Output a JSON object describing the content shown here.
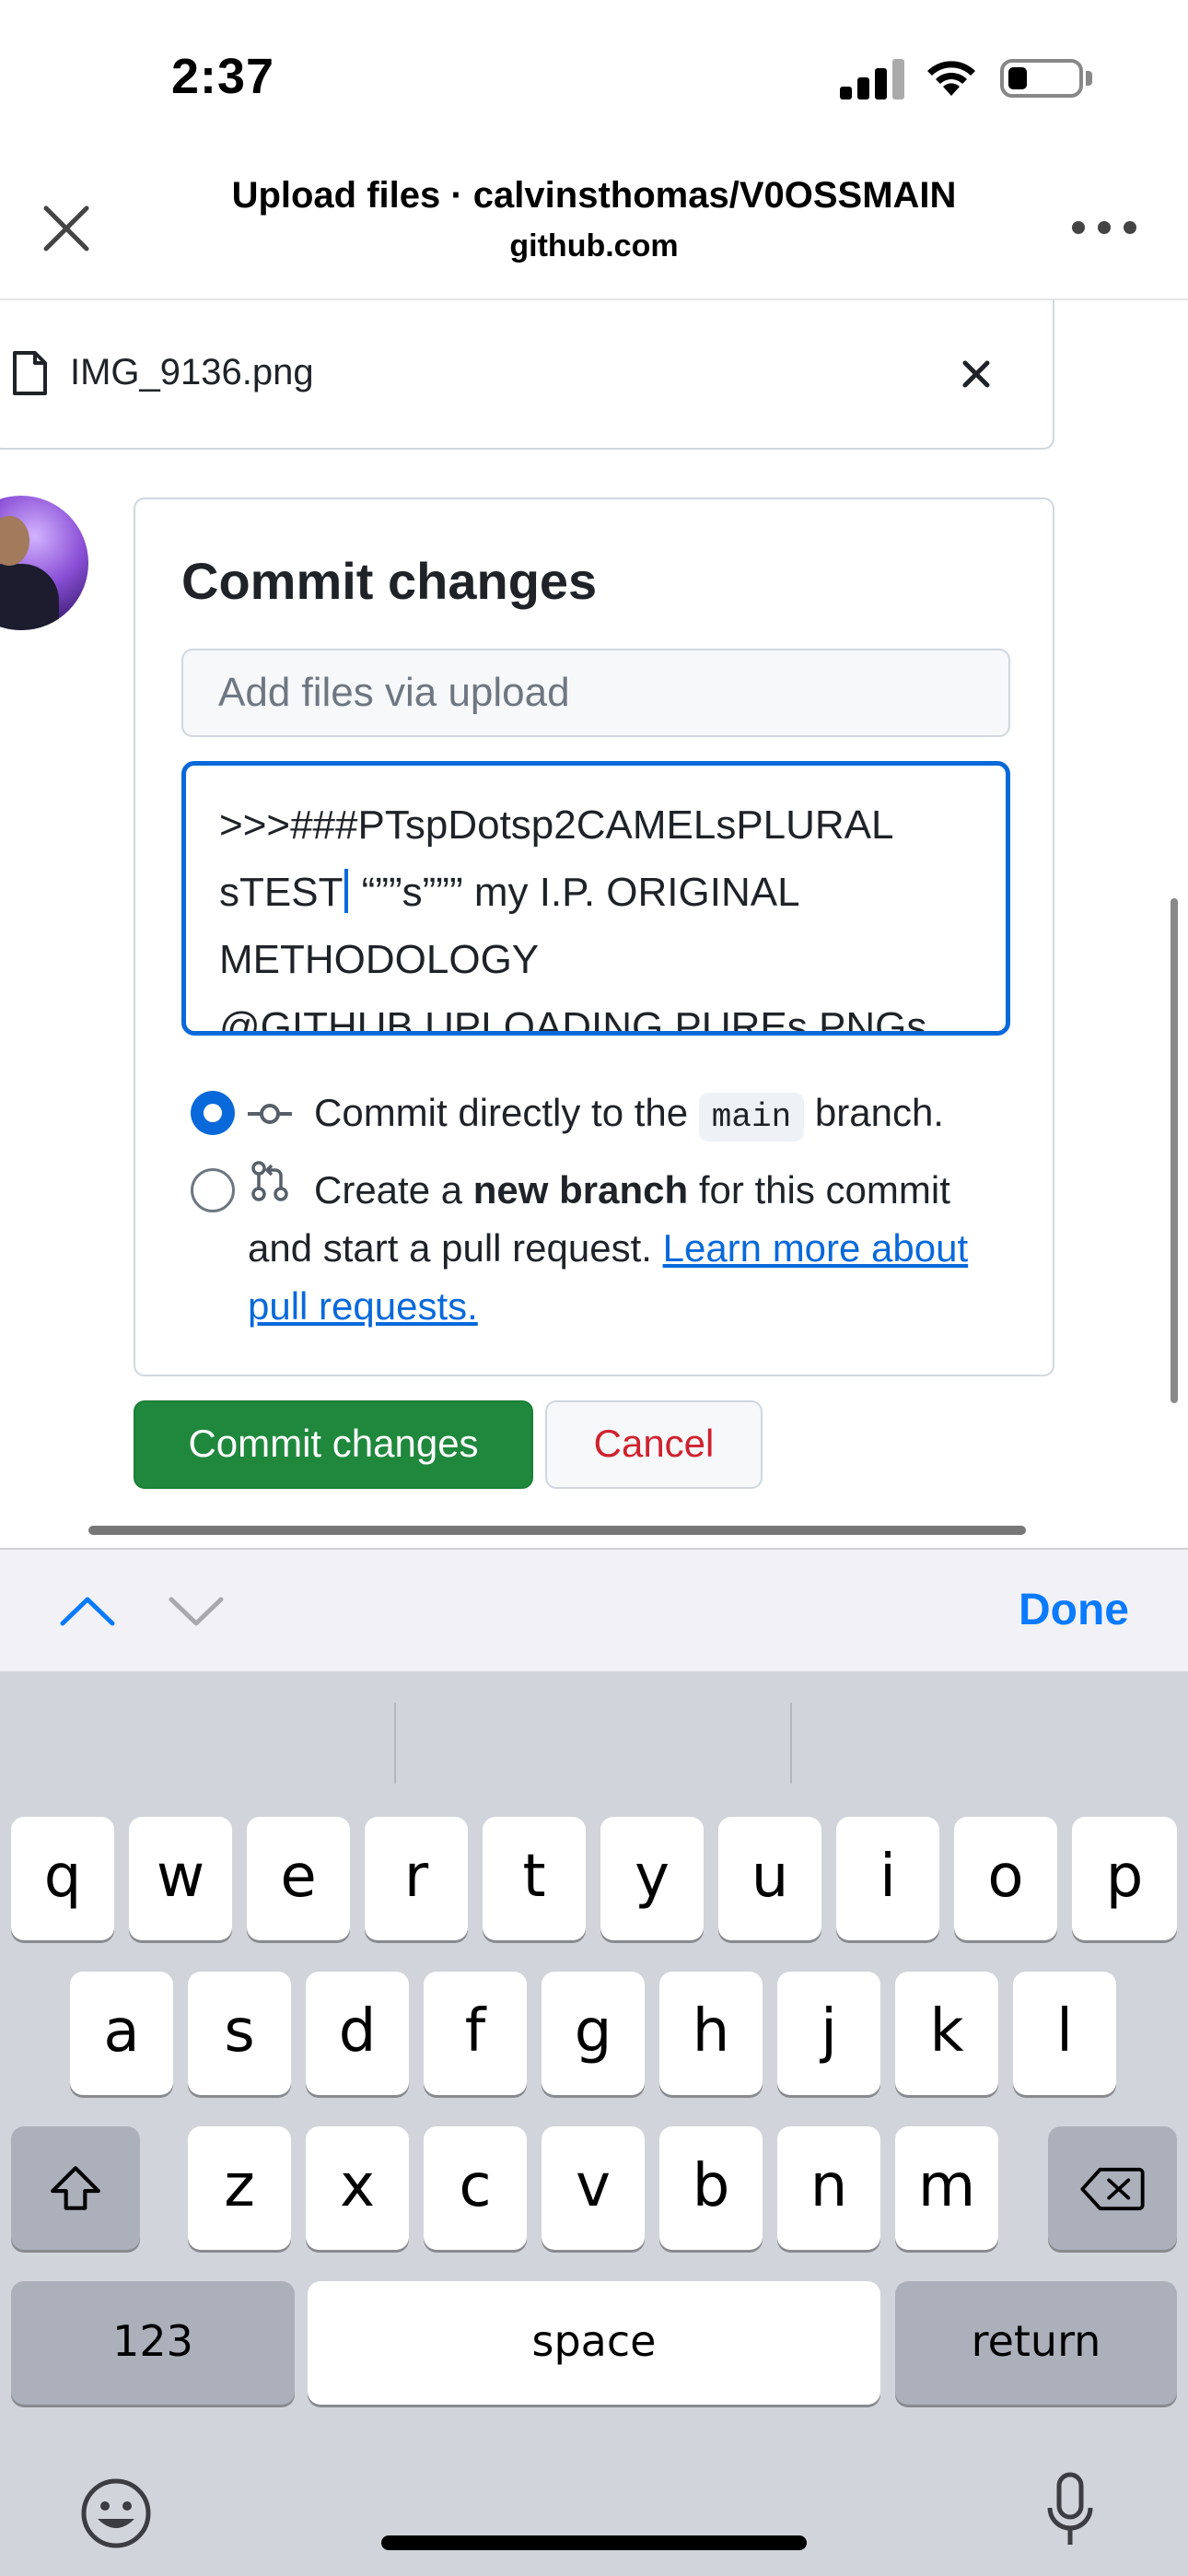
{
  "status_bar": {
    "time": "2:37"
  },
  "browser": {
    "title": "Upload files · calvinsthomas/V0OSSMAIN",
    "domain": "github.com"
  },
  "file": {
    "name": "IMG_9136.png"
  },
  "commit": {
    "heading": "Commit changes",
    "summary_placeholder": "Add files via upload",
    "description_lines": [
      ">>>###PTspDotsp2CAMELsPLURAL",
      "sTEST",
      " “””s””” my I.P. ORIGINAL",
      "METHODOLOGY",
      "@GITHUB UPLOADING PUREs PNGs"
    ],
    "option_direct": {
      "prefix": "Commit directly to the",
      "branch": "main",
      "suffix": "branch."
    },
    "option_new_branch": {
      "prefix": "Create a",
      "bold": "new branch",
      "line1_suffix": "for this commit",
      "line2": "and start a pull request.",
      "link_part1": "Learn more about",
      "link_part2": "pull requests."
    },
    "commit_button": "Commit changes",
    "cancel_button": "Cancel"
  },
  "accessory": {
    "done_label": "Done"
  },
  "keyboard": {
    "row1": [
      "q",
      "w",
      "e",
      "r",
      "t",
      "y",
      "u",
      "i",
      "o",
      "p"
    ],
    "row2": [
      "a",
      "s",
      "d",
      "f",
      "g",
      "h",
      "j",
      "k",
      "l"
    ],
    "row3": [
      "z",
      "x",
      "c",
      "v",
      "b",
      "n",
      "m"
    ],
    "numbers_key": "123",
    "space_key": "space",
    "return_key": "return"
  },
  "icons": [
    "close-icon",
    "more-icon",
    "file-icon",
    "remove-file-icon",
    "commit-icon",
    "branch-icon",
    "chevron-up-icon",
    "chevron-down-icon",
    "shift-icon",
    "backspace-icon",
    "emoji-icon",
    "microphone-icon"
  ],
  "colors": {
    "accent_blue": "#0969da",
    "commit_green": "#1f883d",
    "cancel_red": "#cf222e",
    "done_blue": "#0a7aff"
  }
}
